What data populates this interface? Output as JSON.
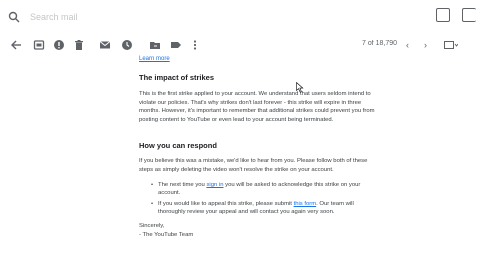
{
  "search": {
    "placeholder": "Search mail"
  },
  "toolbar": {
    "icons": [
      "back-arrow-icon",
      "archive-icon",
      "report-spam-icon",
      "delete-icon",
      "mark-unread-icon",
      "snooze-icon",
      "move-to-icon",
      "label-icon",
      "more-icon"
    ]
  },
  "pager": {
    "text": "7 of 18,790",
    "prev": "‹",
    "next": "›"
  },
  "email": {
    "learn_more": "Learn more",
    "impact_heading": "The impact of strikes",
    "impact_body": "This is the first strike applied to your account. We understand that users seldom intend to violate our policies. That's why strikes don't last forever - this strike will expire in three months. However, it's important to remember that additional strikes could prevent you from posting content to YouTube or even lead to your account being terminated.",
    "respond_heading": "How you can respond",
    "respond_body": "If you believe this was a mistake, we'd like to hear from you. Please follow both of these steps as simply deleting the video won't resolve the strike on your account.",
    "bullet1_pre": "The next time you ",
    "bullet1_link": "sign in",
    "bullet1_post": " you will be asked to acknowledge this strike on your account.",
    "bullet2_pre": "If you would like to appeal this strike, please submit ",
    "bullet2_link": "this form",
    "bullet2_post": ". Our team will thoroughly review your appeal and will contact you again very soon.",
    "signoff_1": "Sincerely,",
    "signoff_2": "- The YouTube Team"
  },
  "colors": {
    "link": "#1a73e8",
    "text": "#3c4043"
  }
}
